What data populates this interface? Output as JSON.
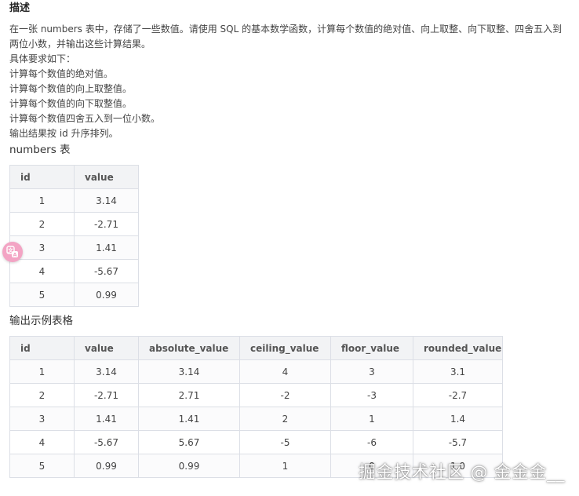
{
  "description": {
    "heading": "描述",
    "intro": "在一张 numbers 表中，存储了一些数值。请使用 SQL 的基本数学函数，计算每个数值的绝对值、向上取整、向下取整、四舍五入到两位小数，并输出这些计算结果。",
    "requirements_title": "具体要求如下：",
    "requirements": [
      "计算每个数值的绝对值。",
      "计算每个数值的向上取整值。",
      "计算每个数值的向下取整值。",
      "计算每个数值四舍五入到一位小数。",
      "输出结果按 id 升序排列。"
    ]
  },
  "numbers_table": {
    "title": "numbers 表",
    "headers": [
      "id",
      "value"
    ],
    "rows": [
      [
        "1",
        "3.14"
      ],
      [
        "2",
        "-2.71"
      ],
      [
        "3",
        "1.41"
      ],
      [
        "4",
        "-5.67"
      ],
      [
        "5",
        "0.99"
      ]
    ]
  },
  "output_table": {
    "title": "输出示例表格",
    "headers": [
      "id",
      "value",
      "absolute_value",
      "ceiling_value",
      "floor_value",
      "rounded_value"
    ],
    "rows": [
      [
        "1",
        "3.14",
        "3.14",
        "4",
        "3",
        "3.1"
      ],
      [
        "2",
        "-2.71",
        "2.71",
        "-2",
        "-3",
        "-2.7"
      ],
      [
        "3",
        "1.41",
        "1.41",
        "2",
        "1",
        "1.4"
      ],
      [
        "4",
        "-5.67",
        "5.67",
        "-5",
        "-6",
        "-5.7"
      ],
      [
        "5",
        "0.99",
        "0.99",
        "1",
        "0",
        "1.0"
      ]
    ]
  },
  "badge": {
    "icon": "translate-icon",
    "color": "#f3a4c4"
  },
  "watermark": {
    "text": "掘金技术社区 @ 金金金__"
  }
}
